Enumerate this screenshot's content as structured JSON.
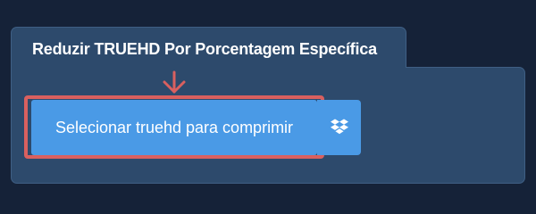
{
  "panel": {
    "title": "Reduzir TRUEHD Por Porcentagem Específica"
  },
  "upload": {
    "button_label": "Selecionar truehd para comprimir",
    "dropbox_icon": "dropbox-icon"
  },
  "annotation": {
    "arrow_icon": "arrow-down-icon"
  },
  "colors": {
    "background": "#152238",
    "panel": "#2d4a6c",
    "button": "#4a9ae6",
    "highlight": "#d9605f",
    "text": "#ffffff"
  }
}
